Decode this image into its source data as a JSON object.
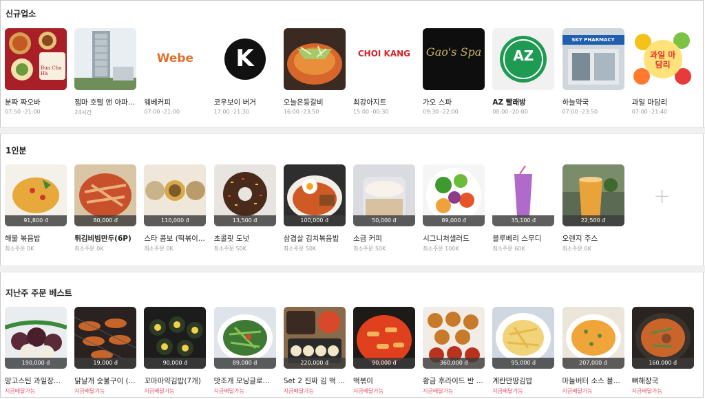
{
  "sections": [
    {
      "title": "신규업소",
      "items": [
        {
          "name": "분짜 짜오바",
          "sub": "07:50 -21:00",
          "icon": "bun-cha-food-photo",
          "logo_text": "Bun Cha Hà"
        },
        {
          "name": "젬마 호텔 앤 아파...",
          "sub": "24시간",
          "icon": "hotel-building-photo"
        },
        {
          "name": "웨베커피",
          "sub": "07:00 -21:00",
          "icon": "webe-coffee-logo",
          "logo_text": "Webe"
        },
        {
          "name": "코우보이 버거",
          "sub": "17:00 -21:30",
          "icon": "k-letter-logo",
          "logo_text": "K"
        },
        {
          "name": "오늘은등갈비",
          "sub": "16:00 -23:50",
          "icon": "ribs-dish-photo"
        },
        {
          "name": "최강아지트",
          "sub": "15:00 -00:30",
          "icon": "choi-kang-logo",
          "logo_text": "CHOI KANG"
        },
        {
          "name": "가오 스파",
          "sub": "09:30 -22:00",
          "icon": "gaos-spa-logo",
          "logo_text": "Gao's Spa"
        },
        {
          "name": "AZ 빨래방",
          "sub": "08:00 -20:00",
          "icon": "az-laundry-logo",
          "logo_text": "AZ"
        },
        {
          "name": "하늘약국",
          "sub": "07:00 -23:50",
          "icon": "pharmacy-storefront-photo",
          "logo_text": "SKY PHARMACY"
        },
        {
          "name": "과일 마담리",
          "sub": "07:00 -21:40",
          "icon": "fruit-madamri-logo",
          "logo_text": "과일 마담리"
        }
      ]
    },
    {
      "title": "1인분",
      "items": [
        {
          "name": "해물 볶음밥",
          "sub": "최소주문 0K",
          "price": "91,800 đ",
          "icon": "fried-rice-photo"
        },
        {
          "name": "튀김비빔만두(6P)",
          "sub": "최소주문 0K",
          "price": "80,000 đ",
          "icon": "fried-dumpling-photo"
        },
        {
          "name": "스타 콤보 (떡볶이...",
          "sub": "최소주문 0K",
          "price": "110,000 đ",
          "icon": "combo-bowls-photo"
        },
        {
          "name": "초콜릿 도넛",
          "sub": "최소주문 50K",
          "price": "13,500 đ",
          "icon": "chocolate-donut-photo"
        },
        {
          "name": "삼겹살 김치볶음밥",
          "sub": "최소주문 50K",
          "price": "100,000 đ",
          "icon": "pork-kimchi-rice-photo"
        },
        {
          "name": "소금 커피",
          "sub": "최소주문 50K",
          "price": "50,000 đ",
          "icon": "salt-coffee-photo"
        },
        {
          "name": "시그니처샐러드",
          "sub": "최소주문 100K",
          "price": "89,000 đ",
          "icon": "salad-photo"
        },
        {
          "name": "블루베리 스무디",
          "sub": "최소주문 60K",
          "price": "35,100 đ",
          "icon": "blueberry-smoothie-photo"
        },
        {
          "name": "오렌지 주스",
          "sub": "최소주문 0K",
          "price": "22,500 đ",
          "icon": "orange-juice-photo"
        }
      ]
    },
    {
      "title": "지난주 주문 베스트",
      "items": [
        {
          "name": "망고스틴 과일장...",
          "sub": "지금배달가능",
          "price": "190,000 đ",
          "icon": "mangosteen-photo"
        },
        {
          "name": "닭날개 숯불구이 (...",
          "sub": "지금배달가능",
          "price": "19,000 đ",
          "icon": "grilled-wings-photo"
        },
        {
          "name": "꼬마마약김밥(7개)",
          "sub": "지금배달가능",
          "price": "90,000 đ",
          "icon": "mini-kimbap-photo"
        },
        {
          "name": "맛조개 모닝글로...",
          "sub": "지금배달가능",
          "price": "89,000 đ",
          "icon": "clam-morning-glory-photo"
        },
        {
          "name": "Set 2 진짜 김 떡 ...",
          "sub": "지금배달가능",
          "price": "220,000 đ",
          "icon": "kimbap-set-photo"
        },
        {
          "name": "떡볶이",
          "sub": "지금배달가능",
          "price": "90,000 đ",
          "icon": "tteokbokki-photo"
        },
        {
          "name": "황금 후라이드 반 ...",
          "sub": "지금배달가능",
          "price": "360,000 đ",
          "icon": "fried-chicken-photo"
        },
        {
          "name": "계란만땅김밥",
          "sub": "지금배달가능",
          "price": "95,000 đ",
          "icon": "egg-kimbap-photo"
        },
        {
          "name": "마늘버터 소스 블...",
          "sub": "지금배달가능",
          "price": "207,000 đ",
          "icon": "garlic-butter-seafood-photo"
        },
        {
          "name": "뼈해장국",
          "sub": "지금배달가능",
          "price": "160,000 đ",
          "icon": "bone-soup-photo"
        }
      ]
    }
  ],
  "more_icon": "plus-icon",
  "colors": {
    "available": "#e8556b",
    "price_overlay": "#3c3c3c",
    "muted": "#9a9a9a"
  }
}
